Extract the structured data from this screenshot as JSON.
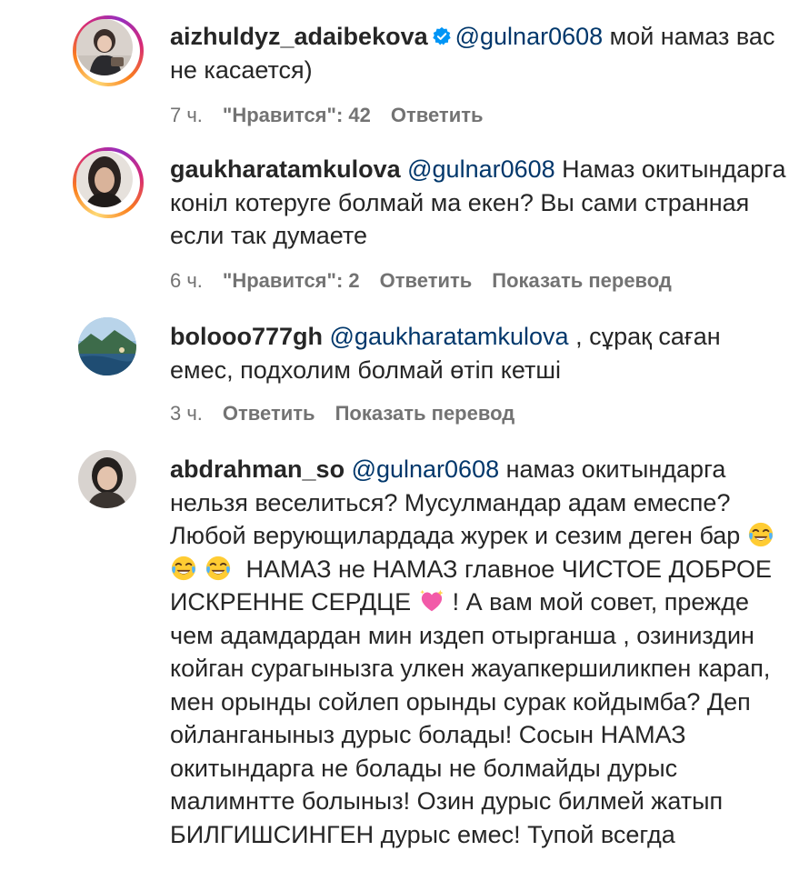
{
  "comments": [
    {
      "username": "aizhuldyz_adaibekova",
      "verified": true,
      "mention": "@gulnar0608",
      "text": " мой намаз вас не касается)",
      "time": "7 ч.",
      "likes": "\"Нравится\": 42",
      "reply": "Ответить",
      "avatar_icon": "profile-photo"
    },
    {
      "username": "gaukharatamkulova",
      "mention": "@gulnar0608",
      "text": " Намаз окитындарга конiл котеруге болмай ма екен? Вы сами странная если так думаете",
      "time": "6 ч.",
      "likes": "\"Нравится\": 2",
      "reply": "Ответить",
      "translate": "Показать перевод",
      "avatar_icon": "profile-photo"
    },
    {
      "username": "bolooo777gh",
      "mention": "@gaukharatamkulova",
      "text": " , сұрақ саған емес, подхолим болмай өтіп кетші",
      "time": "3 ч.",
      "reply": "Ответить",
      "translate": "Показать перевод",
      "avatar_icon": "landscape-photo"
    },
    {
      "username": "abdrahman_so",
      "mention": "@gulnar0608",
      "text_part1": " намаз окитындарга нельзя веселиться? Мусулмандар адам емеспе? Любой верующилардада журек и сезим деген бар ",
      "text_part2": " НАМАЗ не НАМАЗ главное ЧИСТОЕ ДОБРОЕ ИСКРЕННЕ СЕРДЦЕ ",
      "text_part3": "! А вам мой совет, прежде чем адамдардан мин издеп отырганша , озиниздин койган сурагынызга улкен жауапкершиликпен карап, мен орынды сойлеп орынды сурак койдымба? Деп ойланганыныз дурыс болады! Сосын НАМАЗ окитындарга не болады не болмайды дурыс малимнтте болыныз! Озин дурыс билмей жатып БИЛГИШСИНГЕН дурыс емес! Тупой всегда",
      "emoji_laugh": "tears-of-joy-emoji",
      "emoji_heart": "sparkling-heart-emoji",
      "avatar_icon": "profile-photo"
    }
  ],
  "colors": {
    "text": "#262626",
    "mention": "#00376b",
    "meta": "#737373",
    "verified": "#0095f6"
  }
}
